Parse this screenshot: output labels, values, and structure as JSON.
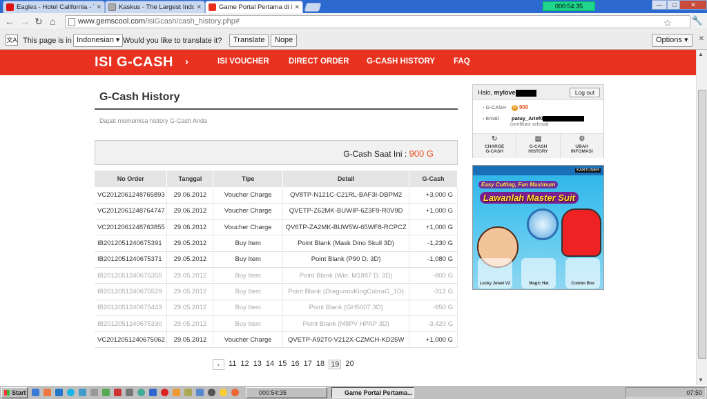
{
  "browser": {
    "tabs": [
      {
        "title": "Eagles - Hotel California - You",
        "icon_color": "#d11"
      },
      {
        "title": "Kaskus - The Largest Indone",
        "icon_color": "#aaa"
      },
      {
        "title": "Game Portal Pertama di Indon",
        "icon_color": "#e8321f"
      }
    ],
    "timer": "000:54:35",
    "url_main": "www.gemscool.com",
    "url_path": "/isiGcash/cash_history.php#",
    "window_controls": {
      "minimize": "—",
      "maximize": "□",
      "close": "✕"
    }
  },
  "translate_bar": {
    "prefix": "This page is in",
    "language": "Indonesian",
    "question": "Would you like to translate it?",
    "translate_label": "Translate",
    "nope_label": "Nope",
    "options_label": "Options"
  },
  "site": {
    "brand": "ISI G-CASH",
    "brand_arrow": "›",
    "menu": [
      "ISI VOUCHER",
      "DIRECT ORDER",
      "G-CASH HISTORY",
      "FAQ"
    ]
  },
  "page": {
    "title": "G-Cash History",
    "subtitle": "Dapat memeriksa history G-Cash Anda",
    "balance_label": "G-Cash Saat Ini :",
    "balance_value": "900 G"
  },
  "table": {
    "headers": [
      "No Order",
      "Tanggal",
      "Tipe",
      "Detail",
      "G-Cash"
    ],
    "rows": [
      {
        "no": "VC2012061248765893",
        "date": "29.06.2012",
        "type": "Voucher Charge",
        "detail": "QV8TP-N121C-C21RL-BAF3I-DBPM2",
        "amount": "+3,000 G"
      },
      {
        "no": "VC2012061248764747",
        "date": "29.06.2012",
        "type": "Voucher Charge",
        "detail": "QVETP-Z62MK-BUWIP-6Z3F9-R0V9D",
        "amount": "+1,000 G"
      },
      {
        "no": "VC2012061248763855",
        "date": "29.06.2012",
        "type": "Voucher Charge",
        "detail": "QV6TP-ZA2MK-BUW5W-65WF8-RCPCZ",
        "amount": "+1,000 G"
      },
      {
        "no": "IB2012051240675391",
        "date": "29.05.2012",
        "type": "Buy Item",
        "detail": "Point Blank (Mask Dino Skull 3D)",
        "amount": "-1,230 G"
      },
      {
        "no": "IB2012051240675371",
        "date": "29.05.2012",
        "type": "Buy Item",
        "detail": "Point Blank (P90 D. 3D)",
        "amount": "-1,080 G"
      },
      {
        "no": "IB2012051240675355",
        "date": "29.05.2012",
        "type": "Buy Item",
        "detail": "Point Blank (Win. M1887 D. 3D)",
        "amount": "-800 G"
      },
      {
        "no": "IB2012051240675529",
        "date": "29.05.2012",
        "type": "Buy Item",
        "detail": "Point Blank (DragunovKingCobraG_1D)",
        "amount": "-312 G"
      },
      {
        "no": "IB2012051240675443",
        "date": "29.05.2012",
        "type": "Buy Item",
        "detail": "Point Blank (GH5007 3D)",
        "amount": "-950 G"
      },
      {
        "no": "IB2012051240675330",
        "date": "29.05.2012",
        "type": "Buy Item",
        "detail": "Point Blank (M8PV HPAP 3D)",
        "amount": "-3,420 G"
      },
      {
        "no": "VC2012051240675062",
        "date": "29.05.2012",
        "type": "Voucher Charge",
        "detail": "QVETP-A92T0-V212X-CZMCH-KD25W",
        "amount": "+1,000 G"
      }
    ]
  },
  "pager": {
    "prev": "‹",
    "pages": [
      "11",
      "12",
      "13",
      "14",
      "15",
      "16",
      "17",
      "18",
      "19",
      "20"
    ],
    "current": "19"
  },
  "user": {
    "greeting": "Halo,",
    "username": "mylove",
    "logout_label": "Log out",
    "gcash_label": "G-CASH",
    "gcash_value": "900",
    "email_label": "Email",
    "email_value": "patuy_Arief0",
    "email_status": "(verifikasi selesai)",
    "actions": [
      {
        "line1": "CHARGE",
        "line2": "G-CASH"
      },
      {
        "line1": "G-CASH",
        "line2": "HISTORY"
      },
      {
        "line1": "UBAH",
        "line2": "INFOMASI"
      }
    ]
  },
  "banner": {
    "tag": "KARTUNER",
    "line1": "Easy Cutting, Fun Maximum",
    "line2": "Lawanlah Master Suit",
    "items": [
      "Lucky Jewel V2",
      "Magic Hat",
      "Combo Box"
    ]
  },
  "taskbar": {
    "start": "Start",
    "timer": "000:54:35",
    "active_window": "Game Portal Pertama...",
    "clock": "07:50"
  }
}
